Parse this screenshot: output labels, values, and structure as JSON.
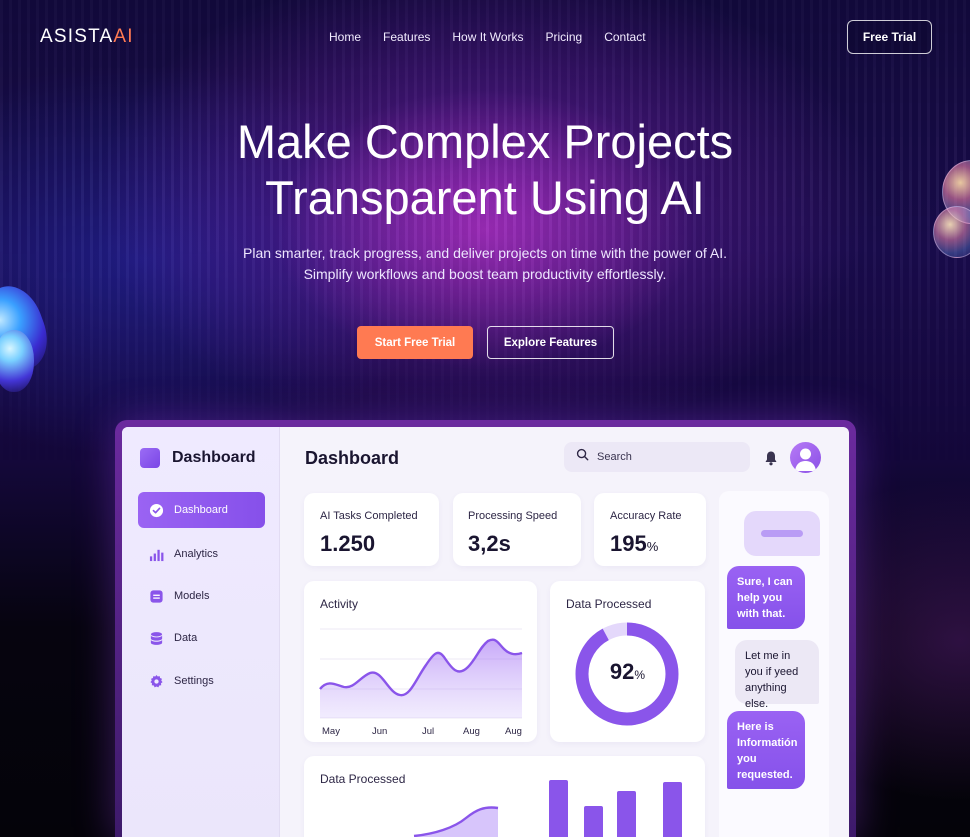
{
  "brand": {
    "name_main": "ASISTA",
    "name_accent": "AI"
  },
  "nav": {
    "links": [
      "Home",
      "Features",
      "How It Works",
      "Pricing",
      "Contact"
    ],
    "cta_label": "Free Trial"
  },
  "hero": {
    "title_line1": "Make Complex Projects",
    "title_line2": "Transparent Using AI",
    "subtitle": "Plan smarter, track progress, and deliver projects on time with the power of AI. Simplify workflows and boost team productivity effortlessly.",
    "primary_button": "Start Free Trial",
    "secondary_button": "Explore Features"
  },
  "dashboard": {
    "sidebar": {
      "title": "Dashboard",
      "items": [
        {
          "label": "Dashboard",
          "icon": "check-circle-icon",
          "active": true
        },
        {
          "label": "Analytics",
          "icon": "bar-chart-icon",
          "active": false
        },
        {
          "label": "Models",
          "icon": "model-icon",
          "active": false
        },
        {
          "label": "Data",
          "icon": "database-icon",
          "active": false
        },
        {
          "label": "Settings",
          "icon": "gear-icon",
          "active": false
        }
      ]
    },
    "header": {
      "title": "Dashboard",
      "search_placeholder": "Search"
    },
    "stats": [
      {
        "label": "AI Tasks Completed",
        "value": "1.250",
        "unit": ""
      },
      {
        "label": "Processing Speed",
        "value": "3,2s",
        "unit": ""
      },
      {
        "label": "Accuracy Rate",
        "value": "195",
        "unit": "%"
      }
    ],
    "activity": {
      "title": "Activity",
      "x_labels": [
        "May",
        "Jun",
        "Jul",
        "Aug",
        "Aug"
      ]
    },
    "data_processed_gauge": {
      "title": "Data Processed",
      "value": "92",
      "unit": "%",
      "fraction": 0.92
    },
    "data_processed_bars": {
      "title": "Data Processed"
    },
    "chat": [
      {
        "text": "",
        "style": "placeholder"
      },
      {
        "text": "Sure, I can help you with that.",
        "style": "assistant"
      },
      {
        "text": "Let me in you if yeed anything else.",
        "style": "user"
      },
      {
        "text": "Here is Informatión you requested.",
        "style": "assistant"
      }
    ]
  },
  "colors": {
    "accent_orange": "#ff7a52",
    "primary_purple": "#8a55ea",
    "background_dark": "#07051a"
  }
}
